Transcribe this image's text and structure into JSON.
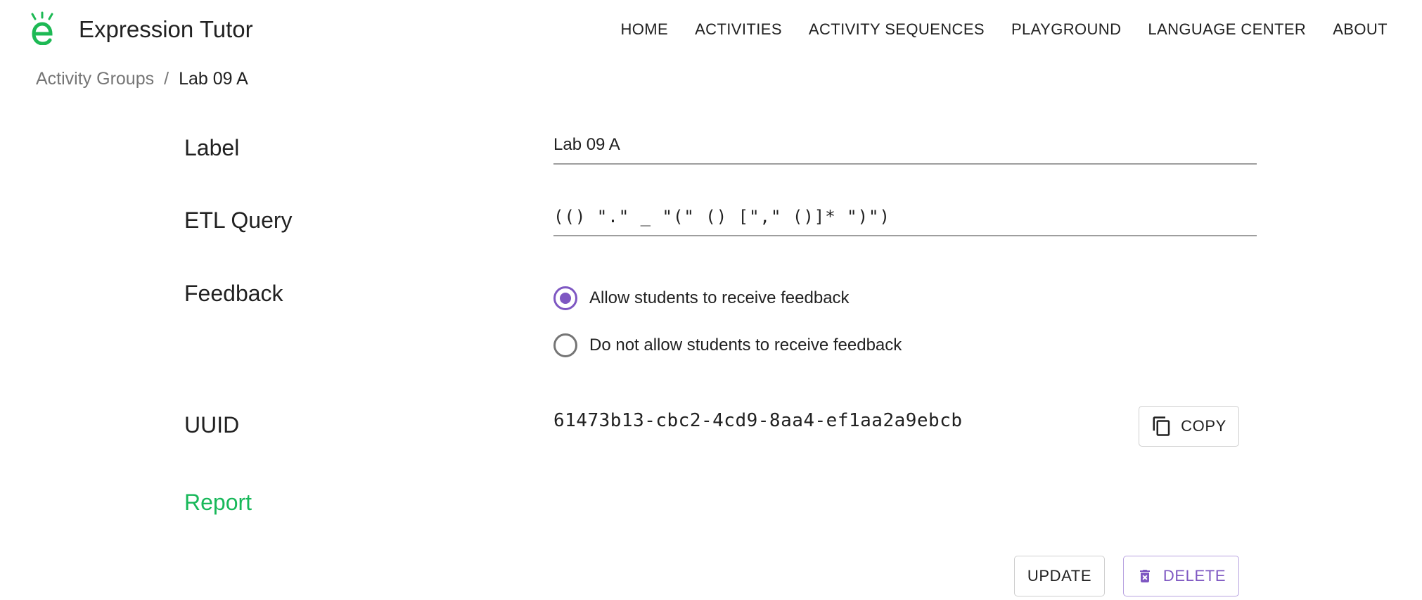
{
  "app": {
    "title": "Expression Tutor",
    "brand_color": "#1db954"
  },
  "nav": {
    "items": [
      {
        "label": "HOME"
      },
      {
        "label": "ACTIVITIES"
      },
      {
        "label": "ACTIVITY SEQUENCES"
      },
      {
        "label": "PLAYGROUND"
      },
      {
        "label": "LANGUAGE CENTER"
      },
      {
        "label": "ABOUT"
      }
    ]
  },
  "breadcrumb": {
    "parent": "Activity Groups",
    "separator": "/",
    "current": "Lab 09 A"
  },
  "form": {
    "label": {
      "title": "Label",
      "value": "Lab 09 A"
    },
    "etl_query": {
      "title": "ETL Query",
      "value": "(() \".\" _ \"(\" () [\",\" ()]* \")\")"
    },
    "feedback": {
      "title": "Feedback",
      "options": [
        {
          "label": "Allow students to receive feedback",
          "selected": true
        },
        {
          "label": "Do not allow students to receive feedback",
          "selected": false
        }
      ]
    },
    "uuid": {
      "title": "UUID",
      "value": "61473b13-cbc2-4cd9-8aa4-ef1aa2a9ebcb",
      "copy_label": "COPY"
    },
    "report_label": "Report"
  },
  "actions": {
    "update_label": "UPDATE",
    "delete_label": "DELETE"
  },
  "colors": {
    "accent": "#7e57c2",
    "report_link": "#18b85a"
  },
  "icons": {
    "copy": "copy-icon",
    "delete": "delete-icon",
    "logo": "logo-icon"
  }
}
